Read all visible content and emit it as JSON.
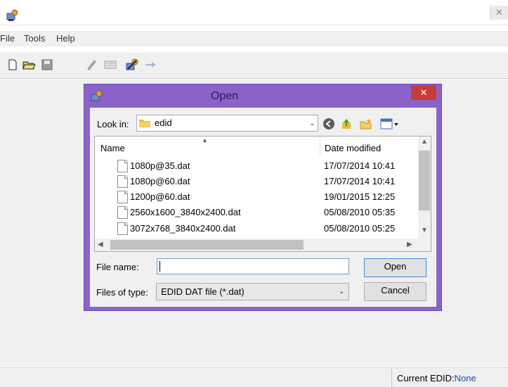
{
  "app": {
    "close_label": "✕",
    "menu": [
      "File",
      "Tools",
      "Help"
    ],
    "toolbar_icons": [
      "new-file-icon",
      "open-folder-icon",
      "save-icon",
      "edit-icon",
      "keyboard-icon",
      "settings-icon",
      "transfer-icon"
    ]
  },
  "dialog": {
    "title": "Open",
    "close_label": "✕",
    "look_in_label": "Look in:",
    "look_in_value": "edid",
    "columns": {
      "name": "Name",
      "date": "Date modified"
    },
    "files": [
      {
        "name": "1080p@35.dat",
        "date": "17/07/2014 10:41"
      },
      {
        "name": "1080p@60.dat",
        "date": "17/07/2014 10:41"
      },
      {
        "name": "1200p@60.dat",
        "date": "19/01/2015 12:25"
      },
      {
        "name": "2560x1600_3840x2400.dat",
        "date": "05/08/2010 05:35"
      },
      {
        "name": "3072x768_3840x2400.dat",
        "date": "05/08/2010 05:25"
      }
    ],
    "file_name_label": "File name:",
    "file_name_value": "",
    "files_of_type_label": "Files of type:",
    "files_of_type_value": "EDID DAT file (*.dat)",
    "open_button": "Open",
    "cancel_button": "Cancel"
  },
  "status": {
    "label": "Current EDID:",
    "value": "None"
  },
  "colors": {
    "dialog_frame": "#8a63c9",
    "close_red": "#c93b3b",
    "status_value": "#1a4fb5"
  }
}
